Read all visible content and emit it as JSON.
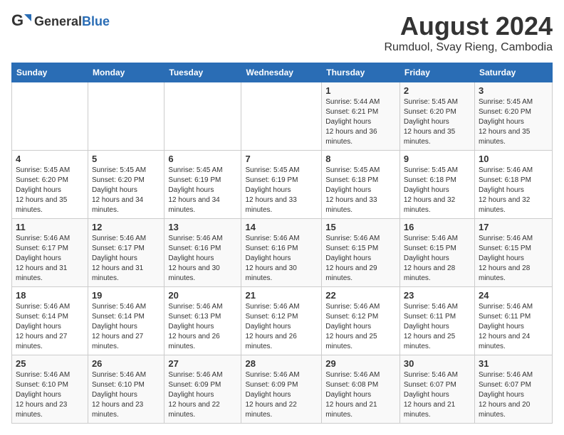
{
  "header": {
    "logo_general": "General",
    "logo_blue": "Blue",
    "title": "August 2024",
    "subtitle": "Rumduol, Svay Rieng, Cambodia"
  },
  "calendar": {
    "weekdays": [
      "Sunday",
      "Monday",
      "Tuesday",
      "Wednesday",
      "Thursday",
      "Friday",
      "Saturday"
    ],
    "weeks": [
      [
        {
          "day": "",
          "sunrise": "",
          "sunset": "",
          "daylight": ""
        },
        {
          "day": "",
          "sunrise": "",
          "sunset": "",
          "daylight": ""
        },
        {
          "day": "",
          "sunrise": "",
          "sunset": "",
          "daylight": ""
        },
        {
          "day": "",
          "sunrise": "",
          "sunset": "",
          "daylight": ""
        },
        {
          "day": "1",
          "sunrise": "5:44 AM",
          "sunset": "6:21 PM",
          "daylight": "12 hours and 36 minutes."
        },
        {
          "day": "2",
          "sunrise": "5:45 AM",
          "sunset": "6:20 PM",
          "daylight": "12 hours and 35 minutes."
        },
        {
          "day": "3",
          "sunrise": "5:45 AM",
          "sunset": "6:20 PM",
          "daylight": "12 hours and 35 minutes."
        }
      ],
      [
        {
          "day": "4",
          "sunrise": "5:45 AM",
          "sunset": "6:20 PM",
          "daylight": "12 hours and 35 minutes."
        },
        {
          "day": "5",
          "sunrise": "5:45 AM",
          "sunset": "6:20 PM",
          "daylight": "12 hours and 34 minutes."
        },
        {
          "day": "6",
          "sunrise": "5:45 AM",
          "sunset": "6:19 PM",
          "daylight": "12 hours and 34 minutes."
        },
        {
          "day": "7",
          "sunrise": "5:45 AM",
          "sunset": "6:19 PM",
          "daylight": "12 hours and 33 minutes."
        },
        {
          "day": "8",
          "sunrise": "5:45 AM",
          "sunset": "6:18 PM",
          "daylight": "12 hours and 33 minutes."
        },
        {
          "day": "9",
          "sunrise": "5:45 AM",
          "sunset": "6:18 PM",
          "daylight": "12 hours and 32 minutes."
        },
        {
          "day": "10",
          "sunrise": "5:46 AM",
          "sunset": "6:18 PM",
          "daylight": "12 hours and 32 minutes."
        }
      ],
      [
        {
          "day": "11",
          "sunrise": "5:46 AM",
          "sunset": "6:17 PM",
          "daylight": "12 hours and 31 minutes."
        },
        {
          "day": "12",
          "sunrise": "5:46 AM",
          "sunset": "6:17 PM",
          "daylight": "12 hours and 31 minutes."
        },
        {
          "day": "13",
          "sunrise": "5:46 AM",
          "sunset": "6:16 PM",
          "daylight": "12 hours and 30 minutes."
        },
        {
          "day": "14",
          "sunrise": "5:46 AM",
          "sunset": "6:16 PM",
          "daylight": "12 hours and 30 minutes."
        },
        {
          "day": "15",
          "sunrise": "5:46 AM",
          "sunset": "6:15 PM",
          "daylight": "12 hours and 29 minutes."
        },
        {
          "day": "16",
          "sunrise": "5:46 AM",
          "sunset": "6:15 PM",
          "daylight": "12 hours and 28 minutes."
        },
        {
          "day": "17",
          "sunrise": "5:46 AM",
          "sunset": "6:15 PM",
          "daylight": "12 hours and 28 minutes."
        }
      ],
      [
        {
          "day": "18",
          "sunrise": "5:46 AM",
          "sunset": "6:14 PM",
          "daylight": "12 hours and 27 minutes."
        },
        {
          "day": "19",
          "sunrise": "5:46 AM",
          "sunset": "6:14 PM",
          "daylight": "12 hours and 27 minutes."
        },
        {
          "day": "20",
          "sunrise": "5:46 AM",
          "sunset": "6:13 PM",
          "daylight": "12 hours and 26 minutes."
        },
        {
          "day": "21",
          "sunrise": "5:46 AM",
          "sunset": "6:12 PM",
          "daylight": "12 hours and 26 minutes."
        },
        {
          "day": "22",
          "sunrise": "5:46 AM",
          "sunset": "6:12 PM",
          "daylight": "12 hours and 25 minutes."
        },
        {
          "day": "23",
          "sunrise": "5:46 AM",
          "sunset": "6:11 PM",
          "daylight": "12 hours and 25 minutes."
        },
        {
          "day": "24",
          "sunrise": "5:46 AM",
          "sunset": "6:11 PM",
          "daylight": "12 hours and 24 minutes."
        }
      ],
      [
        {
          "day": "25",
          "sunrise": "5:46 AM",
          "sunset": "6:10 PM",
          "daylight": "12 hours and 23 minutes."
        },
        {
          "day": "26",
          "sunrise": "5:46 AM",
          "sunset": "6:10 PM",
          "daylight": "12 hours and 23 minutes."
        },
        {
          "day": "27",
          "sunrise": "5:46 AM",
          "sunset": "6:09 PM",
          "daylight": "12 hours and 22 minutes."
        },
        {
          "day": "28",
          "sunrise": "5:46 AM",
          "sunset": "6:09 PM",
          "daylight": "12 hours and 22 minutes."
        },
        {
          "day": "29",
          "sunrise": "5:46 AM",
          "sunset": "6:08 PM",
          "daylight": "12 hours and 21 minutes."
        },
        {
          "day": "30",
          "sunrise": "5:46 AM",
          "sunset": "6:07 PM",
          "daylight": "12 hours and 21 minutes."
        },
        {
          "day": "31",
          "sunrise": "5:46 AM",
          "sunset": "6:07 PM",
          "daylight": "12 hours and 20 minutes."
        }
      ]
    ]
  }
}
